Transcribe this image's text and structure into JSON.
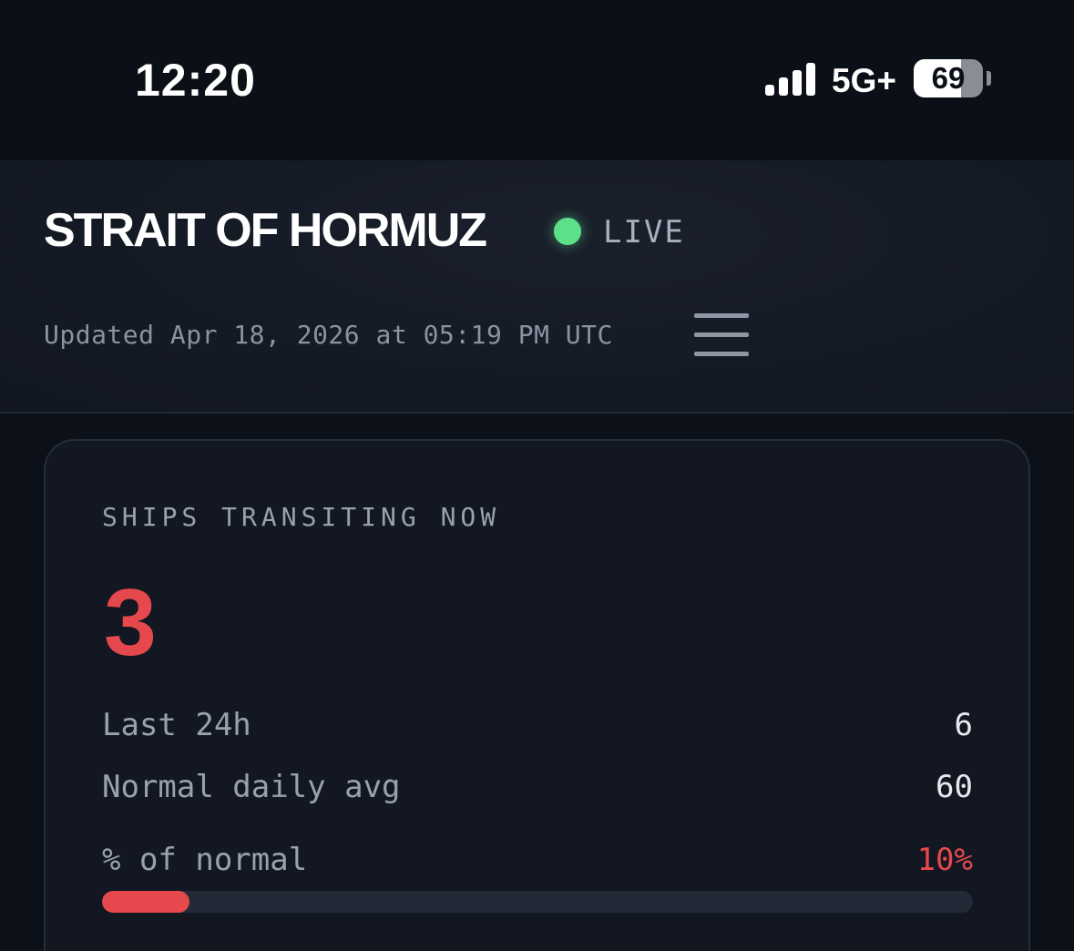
{
  "status_bar": {
    "time": "12:20",
    "network": "5G+",
    "battery_level": "69",
    "battery_fraction": 0.69,
    "signal_icon": "cellular-signal-icon",
    "battery_icon": "battery-icon"
  },
  "header": {
    "title": "STRAIT OF HORMUZ",
    "live_label": "LIVE",
    "live_color": "#5de08a",
    "updated": "Updated Apr 18, 2026 at 05:19 PM UTC",
    "menu_icon": "hamburger-menu-icon"
  },
  "card": {
    "label": "SHIPS TRANSITING NOW",
    "count": "3",
    "rows": [
      {
        "label": "Last 24h",
        "value": "6"
      },
      {
        "label": "Normal daily avg",
        "value": "60"
      }
    ],
    "percent_label": "% of normal",
    "percent_value": "10%",
    "percent_fraction": 0.1,
    "alert_color": "#e5484d"
  }
}
